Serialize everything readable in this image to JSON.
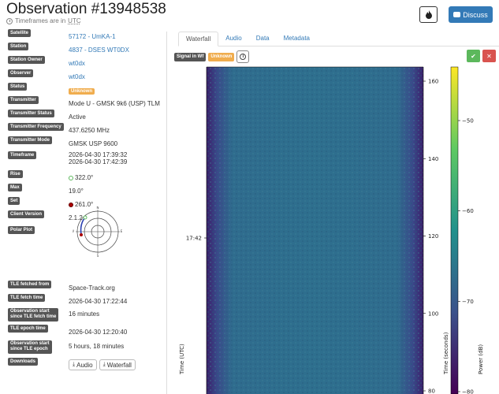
{
  "header": {
    "title": "Observation #13948538",
    "subtitle_prefix": "Timeframes are in",
    "subtitle_utc": "UTC",
    "discuss_label": "Discuss"
  },
  "details": [
    {
      "label": "Satellite",
      "value": "57172 - UmKA-1",
      "link": true
    },
    {
      "label": "Station",
      "value": "4837 - DSES WT0DX",
      "link": true
    },
    {
      "label": "Station Owner",
      "value": "wt0dx",
      "link": true
    },
    {
      "label": "Observer",
      "value": "wt0dx",
      "link": true
    },
    {
      "label": "Status",
      "value": "Unknown",
      "badge": true
    },
    {
      "label": "Transmitter",
      "value": "Mode U - GMSK 9k6 (USP) TLM"
    },
    {
      "label": "Transmitter Status",
      "value": "Active"
    },
    {
      "label": "Transmitter Frequency",
      "value": "437.6250 MHz"
    },
    {
      "label": "Transmitter Mode",
      "value": "GMSK USP 9600"
    },
    {
      "label": "Timeframe",
      "value": "2026-04-30    17:39:32",
      "value2": "2026-04-30    17:42:39"
    },
    {
      "label": "Rise",
      "value": "322.0°"
    },
    {
      "label": "Max",
      "value": "19.0°"
    },
    {
      "label": "Set",
      "value": "261.0°"
    },
    {
      "label": "Client Version",
      "value": "2.1.2"
    },
    {
      "label": "Polar Plot",
      "value": ""
    },
    {
      "label": "TLE fetched from",
      "value": "Space-Track.org"
    },
    {
      "label": "TLE fetch time",
      "value": "2026-04-30    17:22:44"
    },
    {
      "label": "Observation start",
      "label2": "since TLE fetch time",
      "value": "16 minutes"
    },
    {
      "label": "TLE epoch time",
      "value": "2026-04-30    12:20:40"
    },
    {
      "label": "Observation start",
      "label2": "since TLE epoch",
      "value": "5 hours, 18 minutes"
    },
    {
      "label": "Downloads",
      "value": ""
    }
  ],
  "polar": {
    "n": "N",
    "e": "E",
    "s": "S",
    "w": "W"
  },
  "downloads": {
    "audio": "Audio",
    "waterfall": "Waterfall"
  },
  "tabs": [
    "Waterfall",
    "Audio",
    "Data",
    "Metadata"
  ],
  "signal": {
    "label": "Signal in Wf",
    "status": "Unknown"
  },
  "icons": [
    "fire-icon",
    "comment-icon",
    "clock-icon",
    "info-icon",
    "check-icon",
    "close-icon",
    "download-icon"
  ],
  "chart_data": {
    "type": "heatmap",
    "ylabel_left": "Time (UTC)",
    "ylabel_right": "Time (seconds)",
    "colorbar_label": "Power (dB)",
    "left_ticks": [
      "17:42"
    ],
    "right_ticks": [
      160,
      140,
      120,
      100,
      80
    ],
    "colorbar_ticks": [
      -50,
      -60,
      -70,
      -80
    ],
    "colorscale": "viridis"
  },
  "colors": {
    "link": "#337ab7",
    "label_bg": "#555555",
    "badge": "#f0ad4e",
    "ok": "#5cb85c",
    "cancel": "#d9534f"
  }
}
